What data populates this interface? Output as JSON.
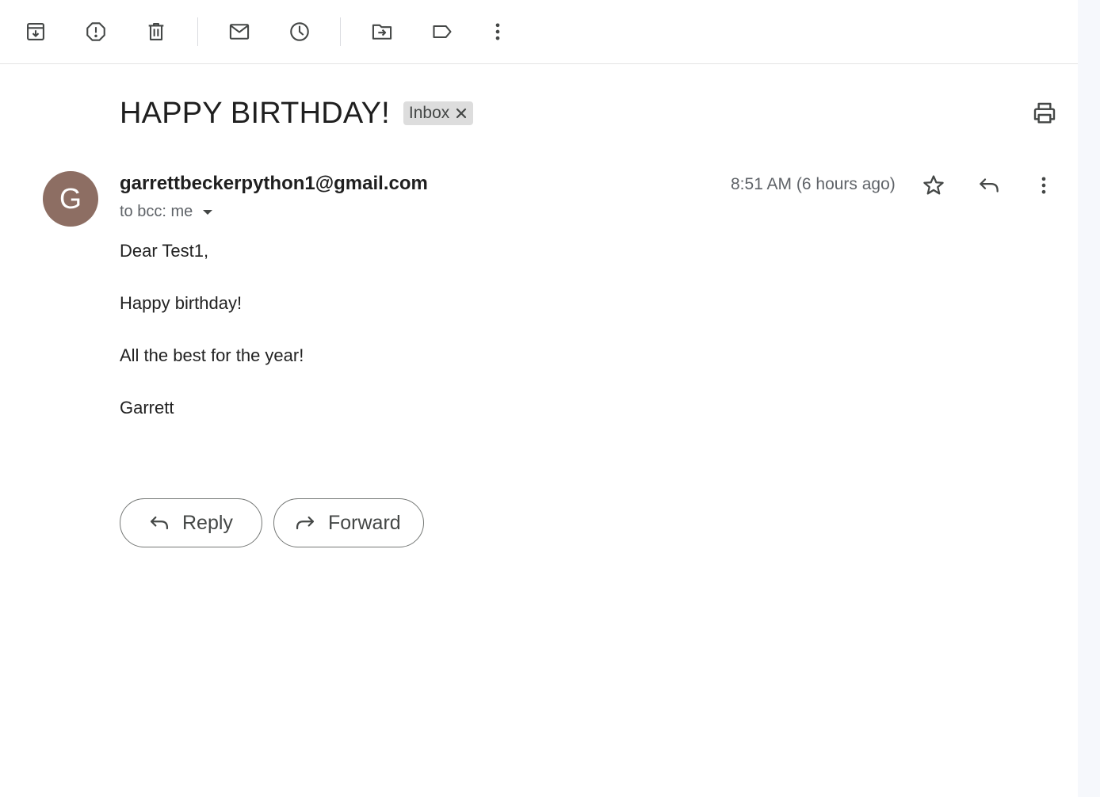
{
  "toolbar": {
    "items": [
      {
        "name": "archive",
        "icon": "archive-icon"
      },
      {
        "name": "report-spam",
        "icon": "report-spam-icon"
      },
      {
        "name": "delete",
        "icon": "trash-icon"
      },
      {
        "name": "mark-unread",
        "icon": "mail-icon"
      },
      {
        "name": "snooze",
        "icon": "clock-icon"
      },
      {
        "name": "move-to",
        "icon": "move-to-folder-icon"
      },
      {
        "name": "labels",
        "icon": "label-icon"
      },
      {
        "name": "more",
        "icon": "more-vert-icon"
      }
    ]
  },
  "message": {
    "subject": "HAPPY BIRTHDAY!",
    "label": "Inbox",
    "sender_initial": "G",
    "sender_email": "garrettbeckerpython1@gmail.com",
    "recipients": "to bcc: me",
    "timestamp": "8:51 AM (6 hours ago)",
    "body": [
      "Dear Test1,",
      "Happy birthday!",
      "All the best for the year!",
      "Garrett"
    ]
  },
  "actions": {
    "reply_label": "Reply",
    "forward_label": "Forward"
  },
  "colors": {
    "avatar_bg": "#8d6e63",
    "label_chip_bg": "#dddddd",
    "icon_color": "#444746",
    "side_strip": "#f6f8fc"
  }
}
